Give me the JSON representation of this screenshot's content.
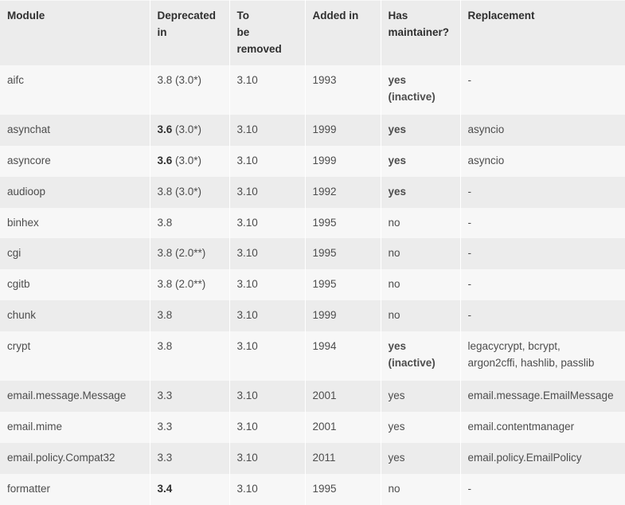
{
  "table": {
    "name": "python-deprecated-modules-table",
    "columns": [
      {
        "key": "module",
        "label": "Module"
      },
      {
        "key": "deprecated",
        "label": "Deprecated in"
      },
      {
        "key": "removed",
        "label": "To be removed"
      },
      {
        "key": "added",
        "label": "Added in"
      },
      {
        "key": "maintainer",
        "label": "Has maintainer?"
      },
      {
        "key": "replacement",
        "label": "Replacement"
      }
    ],
    "rows": [
      {
        "module": "aifc",
        "deprecated_bold": "",
        "deprecated": "3.8 (3.0*)",
        "removed": "3.10",
        "added": "1993",
        "maintainer_line1": "yes",
        "maintainer_line2": "(inactive)",
        "maintainer_bold": true,
        "replacement_line1": "-",
        "replacement_line2": "",
        "tall": true
      },
      {
        "module": "asynchat",
        "deprecated_bold": "3.6",
        "deprecated": " (3.0*)",
        "removed": "3.10",
        "added": "1999",
        "maintainer_line1": "yes",
        "maintainer_line2": "",
        "maintainer_bold": true,
        "replacement_line1": "asyncio",
        "replacement_line2": "",
        "tall": false
      },
      {
        "module": "asyncore",
        "deprecated_bold": "3.6",
        "deprecated": " (3.0*)",
        "removed": "3.10",
        "added": "1999",
        "maintainer_line1": "yes",
        "maintainer_line2": "",
        "maintainer_bold": true,
        "replacement_line1": "asyncio",
        "replacement_line2": "",
        "tall": false
      },
      {
        "module": "audioop",
        "deprecated_bold": "",
        "deprecated": "3.8 (3.0*)",
        "removed": "3.10",
        "added": "1992",
        "maintainer_line1": "yes",
        "maintainer_line2": "",
        "maintainer_bold": true,
        "replacement_line1": "-",
        "replacement_line2": "",
        "tall": false
      },
      {
        "module": "binhex",
        "deprecated_bold": "",
        "deprecated": "3.8",
        "removed": "3.10",
        "added": "1995",
        "maintainer_line1": "no",
        "maintainer_line2": "",
        "maintainer_bold": false,
        "replacement_line1": "-",
        "replacement_line2": "",
        "tall": false
      },
      {
        "module": "cgi",
        "deprecated_bold": "",
        "deprecated": "3.8 (2.0**)",
        "removed": "3.10",
        "added": "1995",
        "maintainer_line1": "no",
        "maintainer_line2": "",
        "maintainer_bold": false,
        "replacement_line1": "-",
        "replacement_line2": "",
        "tall": false
      },
      {
        "module": "cgitb",
        "deprecated_bold": "",
        "deprecated": "3.8 (2.0**)",
        "removed": "3.10",
        "added": "1995",
        "maintainer_line1": "no",
        "maintainer_line2": "",
        "maintainer_bold": false,
        "replacement_line1": "-",
        "replacement_line2": "",
        "tall": false
      },
      {
        "module": "chunk",
        "deprecated_bold": "",
        "deprecated": "3.8",
        "removed": "3.10",
        "added": "1999",
        "maintainer_line1": "no",
        "maintainer_line2": "",
        "maintainer_bold": false,
        "replacement_line1": "-",
        "replacement_line2": "",
        "tall": false
      },
      {
        "module": "crypt",
        "deprecated_bold": "",
        "deprecated": "3.8",
        "removed": "3.10",
        "added": "1994",
        "maintainer_line1": "yes",
        "maintainer_line2": "(inactive)",
        "maintainer_bold": true,
        "replacement_line1": "legacycrypt, bcrypt,",
        "replacement_line2": "argon2cffi, hashlib, passlib",
        "tall": true
      },
      {
        "module": "email.message.Message",
        "deprecated_bold": "",
        "deprecated": "3.3",
        "removed": "3.10",
        "added": "2001",
        "maintainer_line1": "yes",
        "maintainer_line2": "",
        "maintainer_bold": false,
        "replacement_line1": "email.message.EmailMessage",
        "replacement_line2": "",
        "tall": false
      },
      {
        "module": "email.mime",
        "deprecated_bold": "",
        "deprecated": "3.3",
        "removed": "3.10",
        "added": "2001",
        "maintainer_line1": "yes",
        "maintainer_line2": "",
        "maintainer_bold": false,
        "replacement_line1": "email.contentmanager",
        "replacement_line2": "",
        "tall": false
      },
      {
        "module": "email.policy.Compat32",
        "deprecated_bold": "",
        "deprecated": "3.3",
        "removed": "3.10",
        "added": "2011",
        "maintainer_line1": "yes",
        "maintainer_line2": "",
        "maintainer_bold": false,
        "replacement_line1": "email.policy.EmailPolicy",
        "replacement_line2": "",
        "tall": false
      },
      {
        "module": "formatter",
        "deprecated_bold": "3.4",
        "deprecated": "",
        "removed": "3.10",
        "added": "1995",
        "maintainer_line1": "no",
        "maintainer_line2": "",
        "maintainer_bold": false,
        "replacement_line1": "-",
        "replacement_line2": "",
        "tall": false
      }
    ]
  },
  "colors": {
    "header_bg": "#ececec",
    "row_light": "#f7f7f7",
    "row_dark": "#ececec",
    "header_text": "#2f2f2f",
    "body_text": "#4d4d4d",
    "divider": "#ffffff"
  }
}
